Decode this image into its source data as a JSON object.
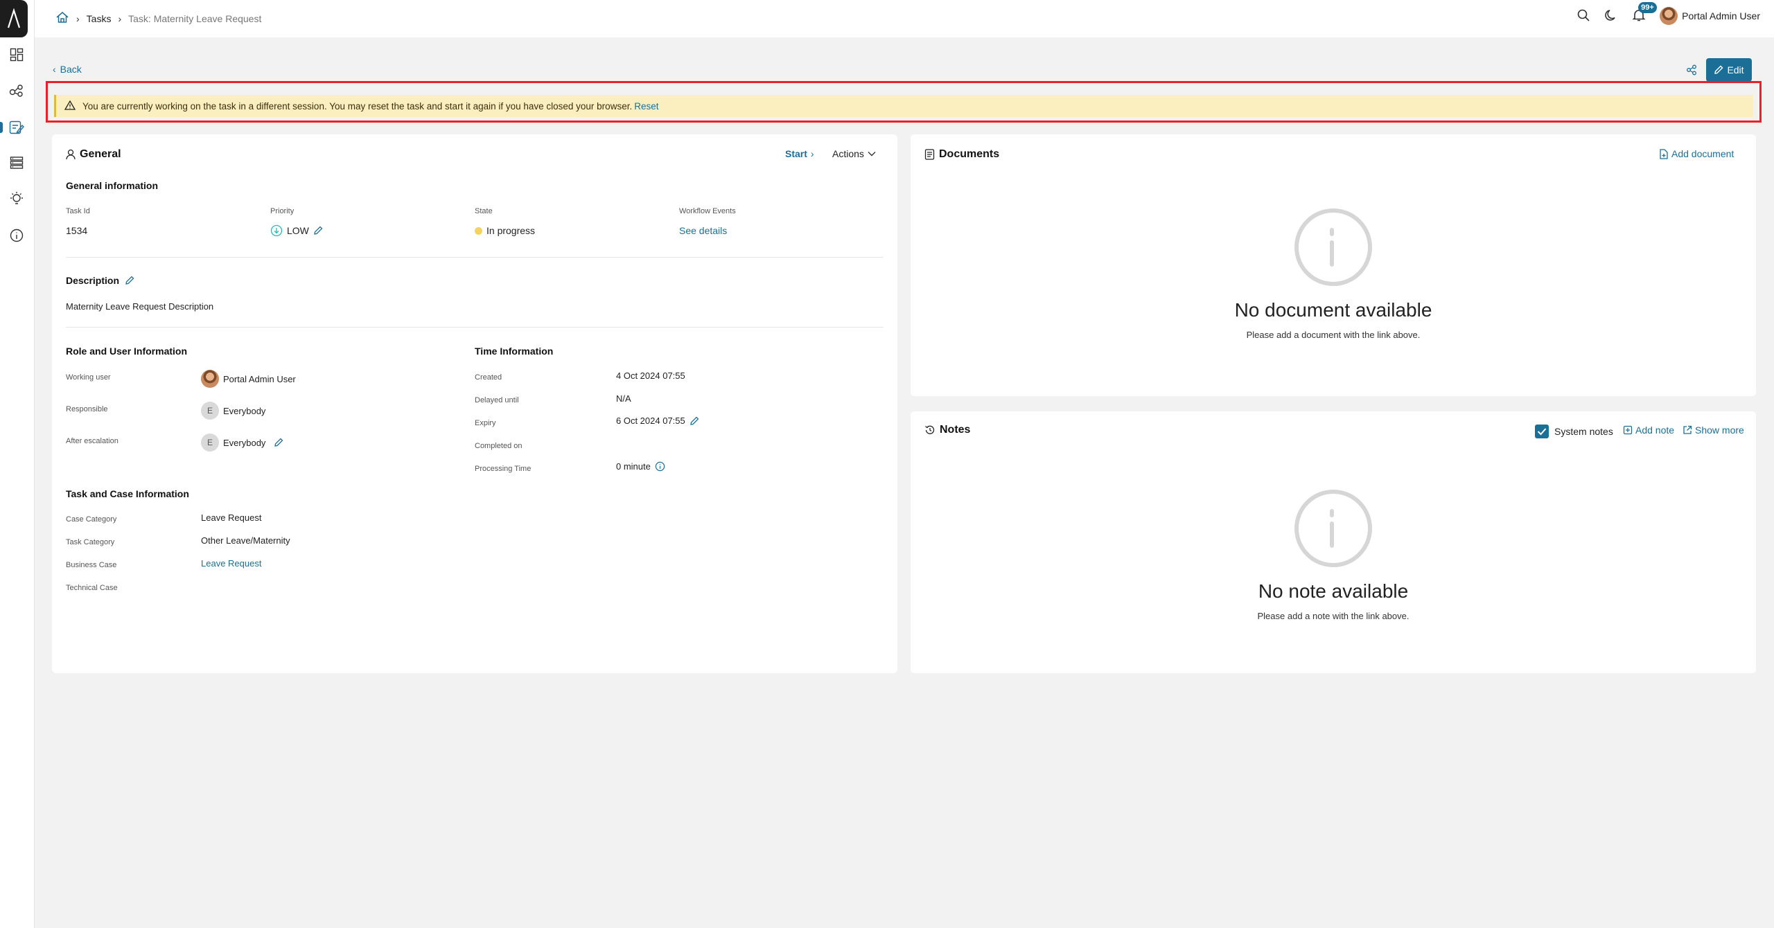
{
  "breadcrumb": {
    "home_icon": "home-icon",
    "items": [
      "Tasks",
      "Task: Maternity Leave Request"
    ]
  },
  "topbar": {
    "notification_count": "99+",
    "user_name": "Portal Admin User"
  },
  "actions": {
    "back_label": "Back",
    "edit_label": "Edit"
  },
  "warning": {
    "message": "You are currently working on the task in a different session. You may reset the task and start it again if you have closed your browser.",
    "reset_label": "Reset"
  },
  "general": {
    "title": "General",
    "start_label": "Start",
    "actions_label": "Actions",
    "info_title": "General information",
    "task_id_label": "Task Id",
    "task_id": "1534",
    "priority_label": "Priority",
    "priority": "LOW",
    "state_label": "State",
    "state": "In progress",
    "workflow_label": "Workflow Events",
    "workflow_link": "See details",
    "description_title": "Description",
    "description": "Maternity Leave Request Description",
    "role_title": "Role and User Information",
    "working_user_label": "Working user",
    "working_user": "Portal Admin User",
    "responsible_label": "Responsible",
    "responsible": "Everybody",
    "after_escalation_label": "After escalation",
    "after_escalation": "Everybody",
    "avatar_initial": "E",
    "time_title": "Time Information",
    "created_label": "Created",
    "created": "4 Oct 2024 07:55",
    "delayed_label": "Delayed until",
    "delayed": "N/A",
    "expiry_label": "Expiry",
    "expiry": "6 Oct 2024 07:55",
    "completed_label": "Completed on",
    "processing_label": "Processing Time",
    "processing": "0 minute",
    "case_title": "Task and Case Information",
    "case_category_label": "Case Category",
    "case_category": "Leave Request",
    "task_category_label": "Task Category",
    "task_category": "Other Leave/Maternity",
    "business_case_label": "Business Case",
    "business_case": "Leave Request",
    "technical_case_label": "Technical Case"
  },
  "documents": {
    "title": "Documents",
    "add_label": "Add document",
    "empty_title": "No document available",
    "empty_sub": "Please add a document with the link above."
  },
  "notes": {
    "title": "Notes",
    "system_notes_label": "System notes",
    "add_label": "Add note",
    "show_more_label": "Show more",
    "empty_title": "No note available",
    "empty_sub": "Please add a note with the link above."
  },
  "colors": {
    "accent": "#1b6e95",
    "warning_bg": "#fcefbf",
    "highlight_border": "#e8202a"
  }
}
